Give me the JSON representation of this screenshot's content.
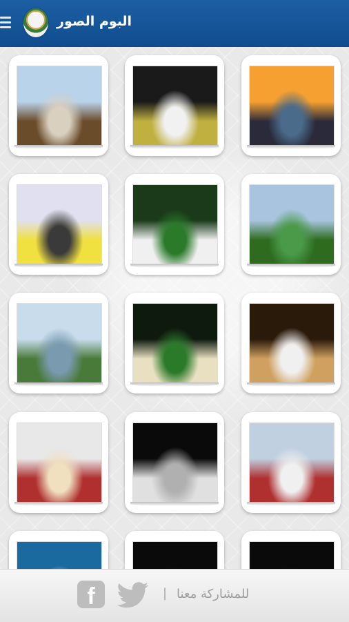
{
  "header": {
    "title": "البوم الصور",
    "menu_icon": "hamburger-menu-icon",
    "logo": "app-logo"
  },
  "gallery": {
    "photos": [
      {
        "name": "photo-sculpture-monument",
        "palette": [
          "#b9d3ea",
          "#6a4b2a",
          "#d9d0c0"
        ]
      },
      {
        "name": "photo-prince-night-ceremony",
        "palette": [
          "#1a1a1a",
          "#c0b040",
          "#f1f1f1"
        ]
      },
      {
        "name": "photo-palm-sunset",
        "palette": [
          "#f5a030",
          "#2a2a3a",
          "#4a6b8a"
        ]
      },
      {
        "name": "photo-crowd-tent",
        "palette": [
          "#e0e0f0",
          "#f0e040",
          "#3a3a3a"
        ]
      },
      {
        "name": "photo-sword-dance",
        "palette": [
          "#1a3a1a",
          "#f0f0f0",
          "#2a7a2a"
        ]
      },
      {
        "name": "photo-palms-seaside",
        "palette": [
          "#a8c4de",
          "#2e6b1e",
          "#4a9a4a"
        ]
      },
      {
        "name": "photo-river-park",
        "palette": [
          "#c8dcec",
          "#4a7a3a",
          "#7a9ab0"
        ]
      },
      {
        "name": "photo-stage-performance",
        "palette": [
          "#0f1a0f",
          "#e8e0c0",
          "#2a7a2a"
        ]
      },
      {
        "name": "photo-reception-hall",
        "palette": [
          "#2a1a0a",
          "#d0a060",
          "#f0f0f0"
        ]
      },
      {
        "name": "photo-award-handover",
        "palette": [
          "#e8e8e8",
          "#b03030",
          "#f0e0c0"
        ]
      },
      {
        "name": "photo-stadium-crowd",
        "palette": [
          "#0a0a0a",
          "#e0e0e0",
          "#b0b0b0"
        ]
      },
      {
        "name": "photo-officials-award",
        "palette": [
          "#c0d0e0",
          "#b03030",
          "#f0f0f0"
        ]
      },
      {
        "name": "photo-colorful-lights",
        "palette": [
          "#1a6aa0",
          "#e0c030",
          "#f0f0f0"
        ]
      },
      {
        "name": "photo-dark-1",
        "palette": [
          "#0a0a0a",
          "#0a0a0a",
          "#1a1a1a"
        ]
      },
      {
        "name": "photo-dark-2",
        "palette": [
          "#0a0a0a",
          "#0a0a0a",
          "#1a1a1a"
        ]
      }
    ]
  },
  "footer": {
    "share_text": "للمشاركة معنا",
    "separator": "|",
    "facebook_icon": "facebook-icon",
    "twitter_icon": "twitter-icon"
  }
}
